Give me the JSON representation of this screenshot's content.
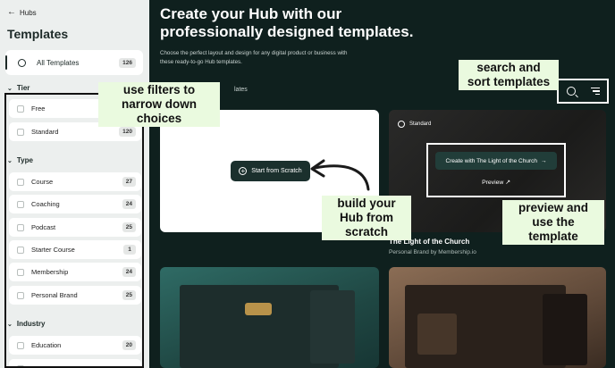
{
  "sidebar": {
    "back_label": "Hubs",
    "title": "Templates",
    "all_templates": {
      "label": "All Templates",
      "count": "126"
    },
    "sections": {
      "tier": {
        "label": "Tier",
        "items": [
          {
            "label": "Free",
            "count": ""
          },
          {
            "label": "Standard",
            "count": "120"
          }
        ]
      },
      "type": {
        "label": "Type",
        "items": [
          {
            "label": "Course",
            "count": "27"
          },
          {
            "label": "Coaching",
            "count": "24"
          },
          {
            "label": "Podcast",
            "count": "25"
          },
          {
            "label": "Starter Course",
            "count": "1"
          },
          {
            "label": "Membership",
            "count": "24"
          },
          {
            "label": "Personal Brand",
            "count": "25"
          }
        ]
      },
      "industry": {
        "label": "Industry",
        "items": [
          {
            "label": "Education",
            "count": "20"
          }
        ]
      }
    }
  },
  "hero": {
    "title": "Create your Hub with our professionally designed templates.",
    "subtitle": "Choose the perfect layout and design for any digital product or business with these ready-to-go Hub templates."
  },
  "toolbar": {
    "partial_label": "lates"
  },
  "cards": {
    "scratch": {
      "button_label": "Start from Scratch"
    },
    "church": {
      "tier": "Standard",
      "use_label": "Create with The Light of the Church",
      "preview_label": "Preview",
      "name": "The Light of the Church",
      "author": "Personal Brand by Membership.io"
    }
  },
  "callouts": {
    "filters": "use filters to narrow down choices",
    "search": "search and sort templates",
    "build": "build your Hub from scratch",
    "preview": "preview and use the template"
  }
}
